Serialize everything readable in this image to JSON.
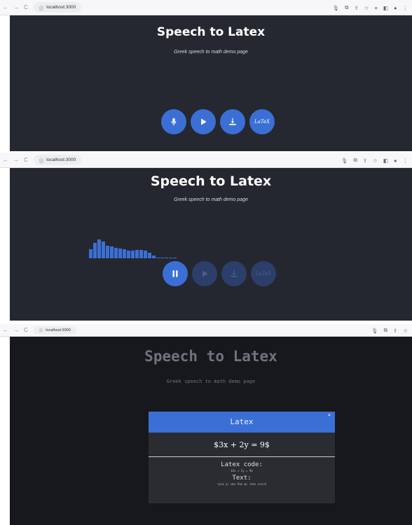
{
  "browser": {
    "url": "localhost:3000"
  },
  "app": {
    "title": "Speech to Latex",
    "subtitle": "Greek speech to math demo page"
  },
  "controls": {
    "latex_logo": "LaTeX",
    "icons": [
      "microphone-icon",
      "play-icon",
      "download-icon",
      "latex-icon"
    ],
    "recording_icons": [
      "pause-icon",
      "play-icon",
      "download-icon",
      "latex-icon"
    ]
  },
  "waveform": {
    "levels": [
      0.45,
      0.8,
      0.95,
      0.85,
      0.65,
      0.6,
      0.55,
      0.5,
      0.45,
      0.4,
      0.38,
      0.42,
      0.42,
      0.38,
      0.3,
      0.15,
      0.05,
      0.05,
      0.05,
      0.05,
      0.05
    ]
  },
  "modal": {
    "header": "Latex",
    "close": "×",
    "result": "$3x + 2y = 9$",
    "code_label": "Latex code:",
    "code_value": "$3x + 2y = 9$",
    "text_label": "Text:",
    "text_value": "τρία χι συν δύο ψι ίσον εννιά"
  },
  "colors": {
    "accent": "#3b6fd6",
    "background": "#252830"
  }
}
